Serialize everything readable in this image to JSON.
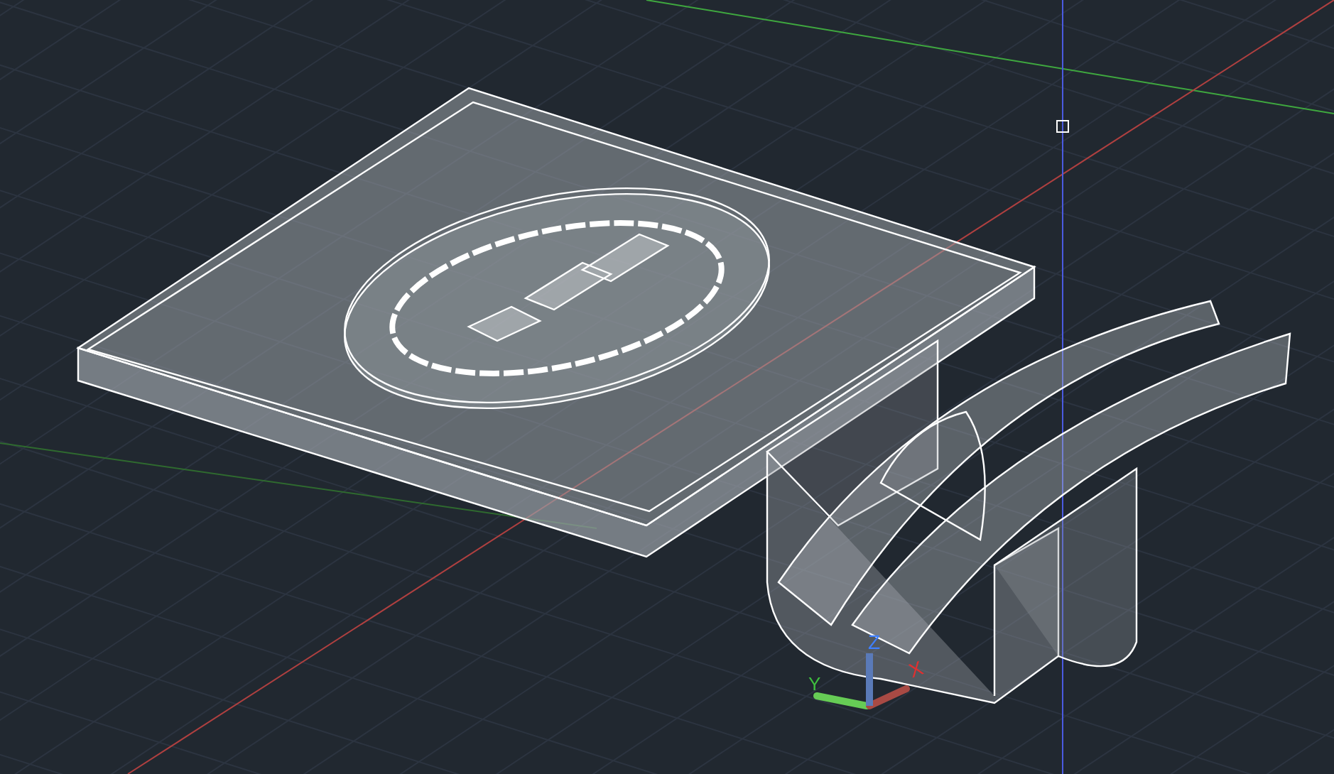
{
  "viewport": {
    "ucs_icon": {
      "x_label": "X",
      "y_label": "Y",
      "z_label": "Z"
    }
  }
}
